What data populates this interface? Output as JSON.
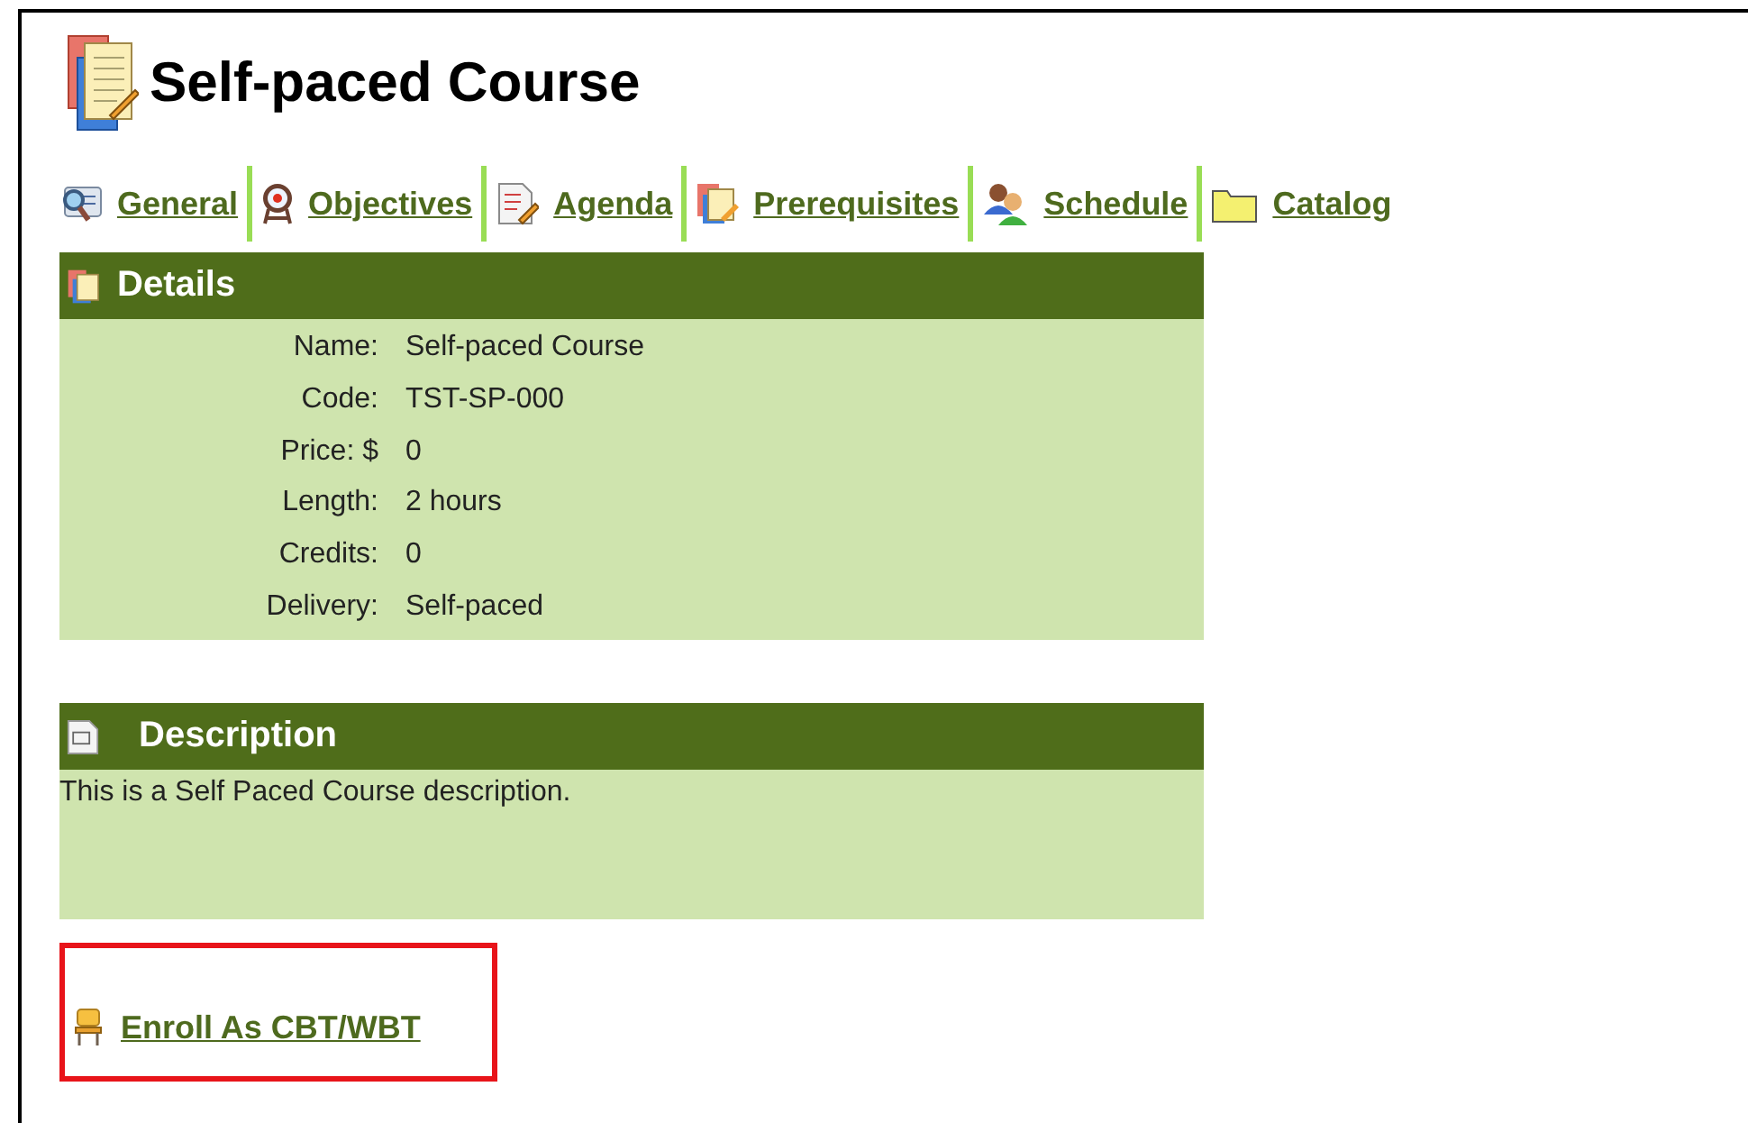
{
  "page": {
    "title": "Self-paced Course"
  },
  "tabs": [
    {
      "label": "General",
      "kind": "general"
    },
    {
      "label": "Objectives",
      "kind": "objectives"
    },
    {
      "label": "Agenda",
      "kind": "agenda"
    },
    {
      "label": "Prerequisites",
      "kind": "prerequisites"
    },
    {
      "label": "Schedule",
      "kind": "schedule"
    },
    {
      "label": "Catalog",
      "kind": "catalog"
    }
  ],
  "details": {
    "title": "Details",
    "rows": [
      {
        "label": "Name:",
        "value": "Self-paced Course"
      },
      {
        "label": "Code:",
        "value": "TST-SP-000"
      },
      {
        "label": "Price: $",
        "value": "0"
      },
      {
        "label": "Length:",
        "value": "2 hours"
      },
      {
        "label": "Credits:",
        "value": "0"
      },
      {
        "label": "Delivery:",
        "value": "Self-paced"
      }
    ]
  },
  "description": {
    "title": "Description",
    "text": "This is a Self Paced Course description."
  },
  "enroll": {
    "label": "Enroll As CBT/WBT",
    "highlighted": true
  }
}
